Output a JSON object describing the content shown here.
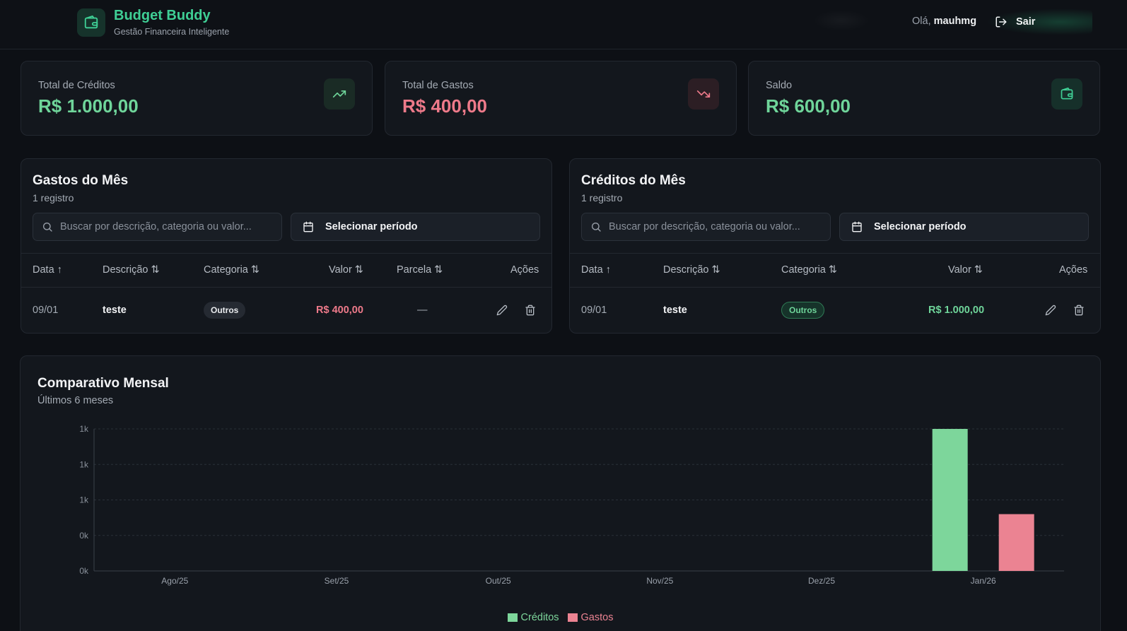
{
  "header": {
    "title": "Budget Buddy",
    "subtitle": "Gestão Financeira Inteligente",
    "greeting_prefix": "Olá,",
    "username": "mauhmg",
    "logout_label": "Sair"
  },
  "stats": [
    {
      "label": "Total de Créditos",
      "value": "R$ 1.000,00",
      "icon": "trending-up-icon"
    },
    {
      "label": "Total de Gastos",
      "value": "R$ 400,00",
      "icon": "trending-down-icon"
    },
    {
      "label": "Saldo",
      "value": "R$ 600,00",
      "icon": "wallet-icon"
    }
  ],
  "expenses": {
    "title": "Gastos do Mês",
    "count": "1 registro",
    "search_placeholder": "Buscar por descrição, categoria ou valor...",
    "period_label": "Selecionar período",
    "columns": [
      "Data",
      "Descrição",
      "Categoria",
      "Valor",
      "Parcela",
      "Ações"
    ],
    "rows": [
      {
        "date": "09/01",
        "description": "teste",
        "category": "Outros",
        "value": "R$ 400,00",
        "installment": "—"
      }
    ]
  },
  "credits": {
    "title": "Créditos do Mês",
    "count": "1 registro",
    "search_placeholder": "Buscar por descrição, categoria ou valor...",
    "period_label": "Selecionar período",
    "columns": [
      "Data",
      "Descrição",
      "Categoria",
      "Valor",
      "Ações"
    ],
    "rows": [
      {
        "date": "09/01",
        "description": "teste",
        "category": "Outros",
        "value": "R$ 1.000,00"
      }
    ]
  },
  "chart_panel": {
    "title": "Comparativo Mensal",
    "subtitle": "Últimos 6 meses"
  },
  "colors": {
    "accent": "#3fcf95",
    "credit": "#7dd69b",
    "expense": "#eb8392"
  },
  "chart_data": {
    "type": "bar",
    "categories": [
      "Ago/25",
      "Set/25",
      "Out/25",
      "Nov/25",
      "Dez/25",
      "Jan/26"
    ],
    "series": [
      {
        "name": "Créditos",
        "values": [
          0,
          0,
          0,
          0,
          0,
          1000
        ]
      },
      {
        "name": "Gastos",
        "values": [
          0,
          0,
          0,
          0,
          0,
          400
        ]
      }
    ],
    "y_tick_labels": [
      "0k",
      "0k",
      "1k",
      "1k",
      "1k"
    ],
    "ylim": [
      0,
      1000
    ],
    "grid": true,
    "legend_position": "bottom-center"
  }
}
